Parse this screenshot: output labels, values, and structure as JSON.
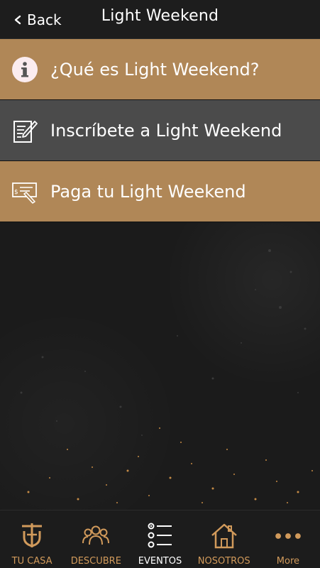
{
  "header": {
    "back_label": "Back",
    "title": "Light Weekend"
  },
  "menu": {
    "items": [
      {
        "label": "¿Qué es Light Weekend?",
        "icon": "info-icon",
        "color": "#b08757"
      },
      {
        "label": "Inscríbete a Light Weekend",
        "icon": "edit-document-icon",
        "color": "#4b4b4b"
      },
      {
        "label": "Paga tu Light Weekend",
        "icon": "payment-check-icon",
        "color": "#b08757"
      }
    ]
  },
  "tabbar": {
    "items": [
      {
        "label": "TU CASA",
        "icon": "church-logo-icon"
      },
      {
        "label": "DESCUBRE",
        "icon": "people-icon"
      },
      {
        "label": "EVENTOS",
        "icon": "list-icon"
      },
      {
        "label": "NOSOTROS",
        "icon": "house-icon"
      },
      {
        "label": "More",
        "icon": "more-dots-icon"
      }
    ],
    "active_index": 2,
    "accent": "#d19a5b"
  }
}
